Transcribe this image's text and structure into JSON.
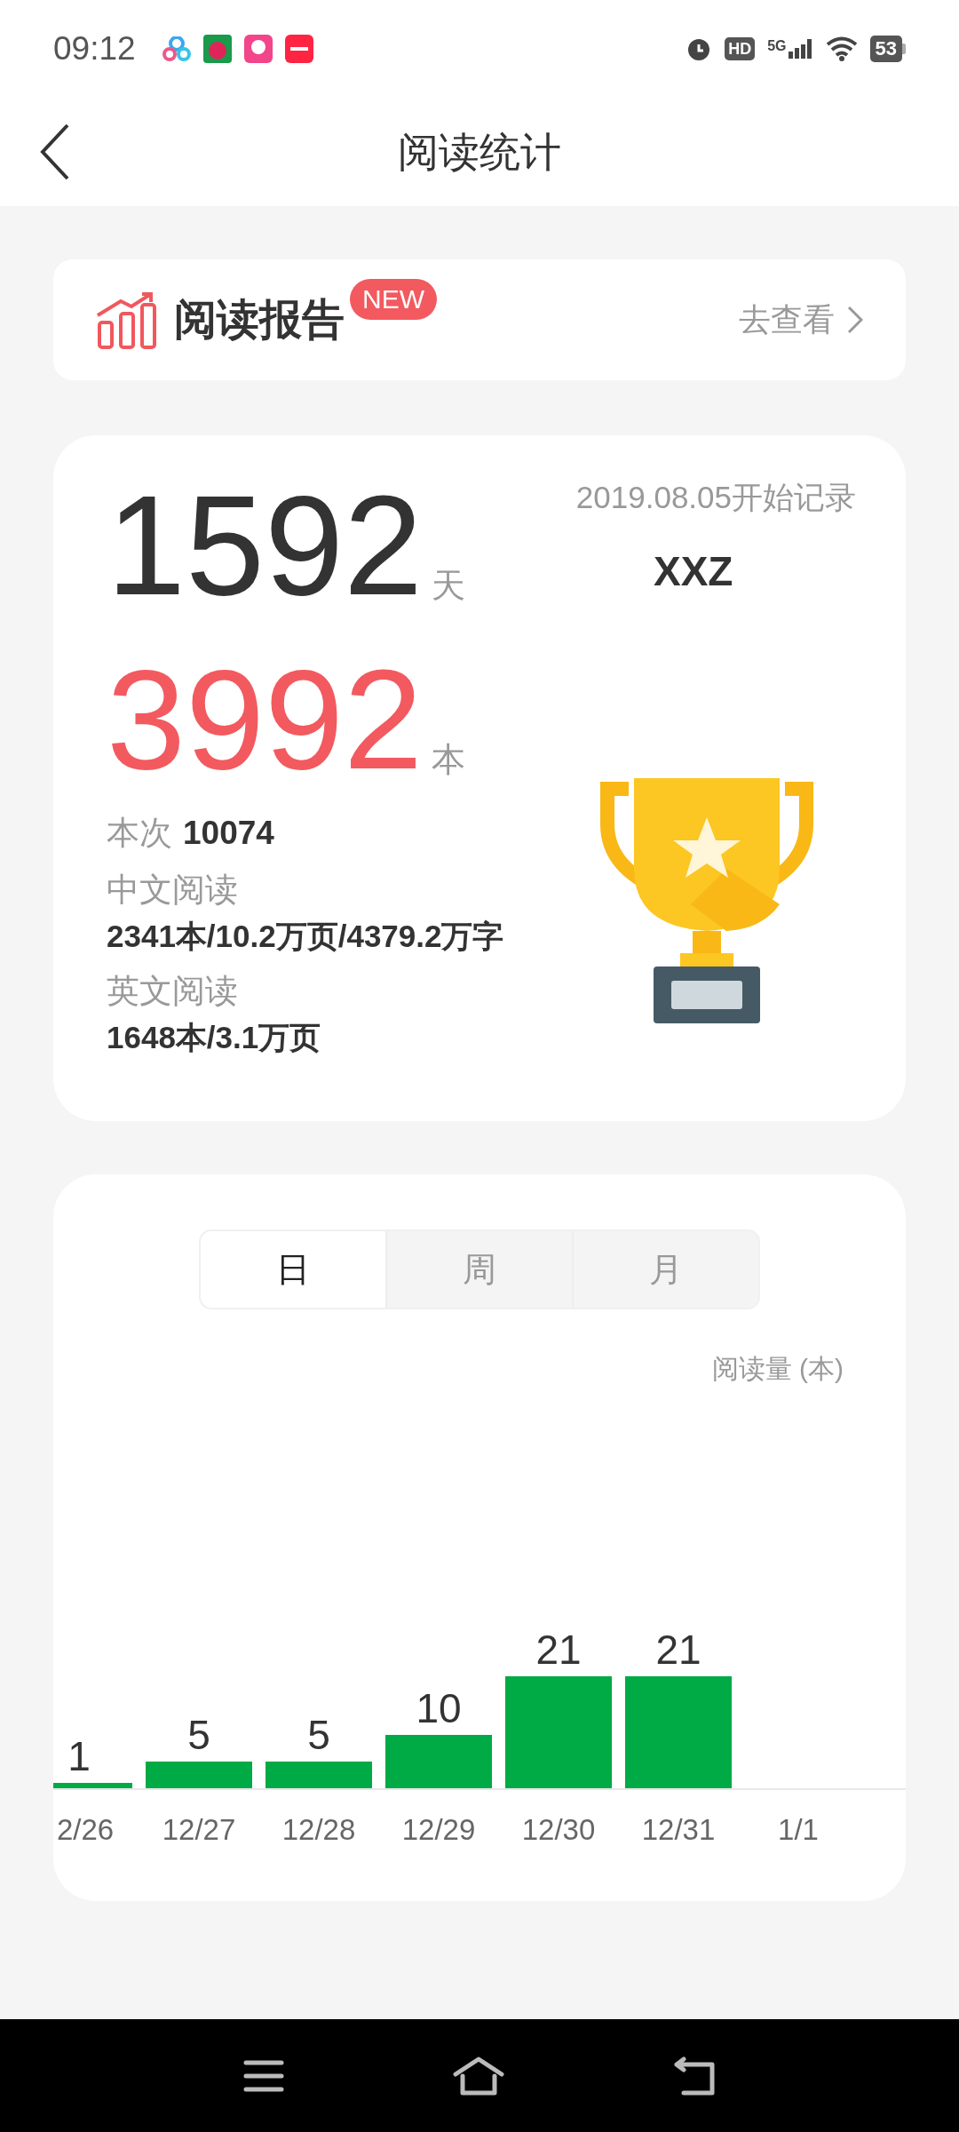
{
  "status_bar": {
    "time": "09:12",
    "hd": "HD",
    "network": "5G",
    "battery": "53"
  },
  "header": {
    "title": "阅读统计"
  },
  "report": {
    "title": "阅读报告",
    "badge": "NEW",
    "link": "去查看"
  },
  "summary": {
    "days": "1592",
    "days_unit": "天",
    "since": "2019.08.05开始记录",
    "name": "XXZ",
    "books": "3992",
    "books_unit": "本",
    "session_label": "本次",
    "session_value": "10074",
    "sections": [
      {
        "label": "中文阅读",
        "value": "2341本/10.2万页/4379.2万字"
      },
      {
        "label": "英文阅读",
        "value": "1648本/3.1万页"
      }
    ]
  },
  "period_tabs": [
    {
      "label": "日",
      "selected": true
    },
    {
      "label": "周",
      "selected": false
    },
    {
      "label": "月",
      "selected": false
    }
  ],
  "chart": {
    "chart_data": {
      "type": "bar",
      "ylabel": "阅读量 (本)",
      "categories": [
        "2/26",
        "12/27",
        "12/28",
        "12/29",
        "12/30",
        "12/31",
        "1/1"
      ],
      "values": [
        1,
        5,
        5,
        10,
        21,
        21,
        null
      ],
      "data_labels": true
    }
  }
}
